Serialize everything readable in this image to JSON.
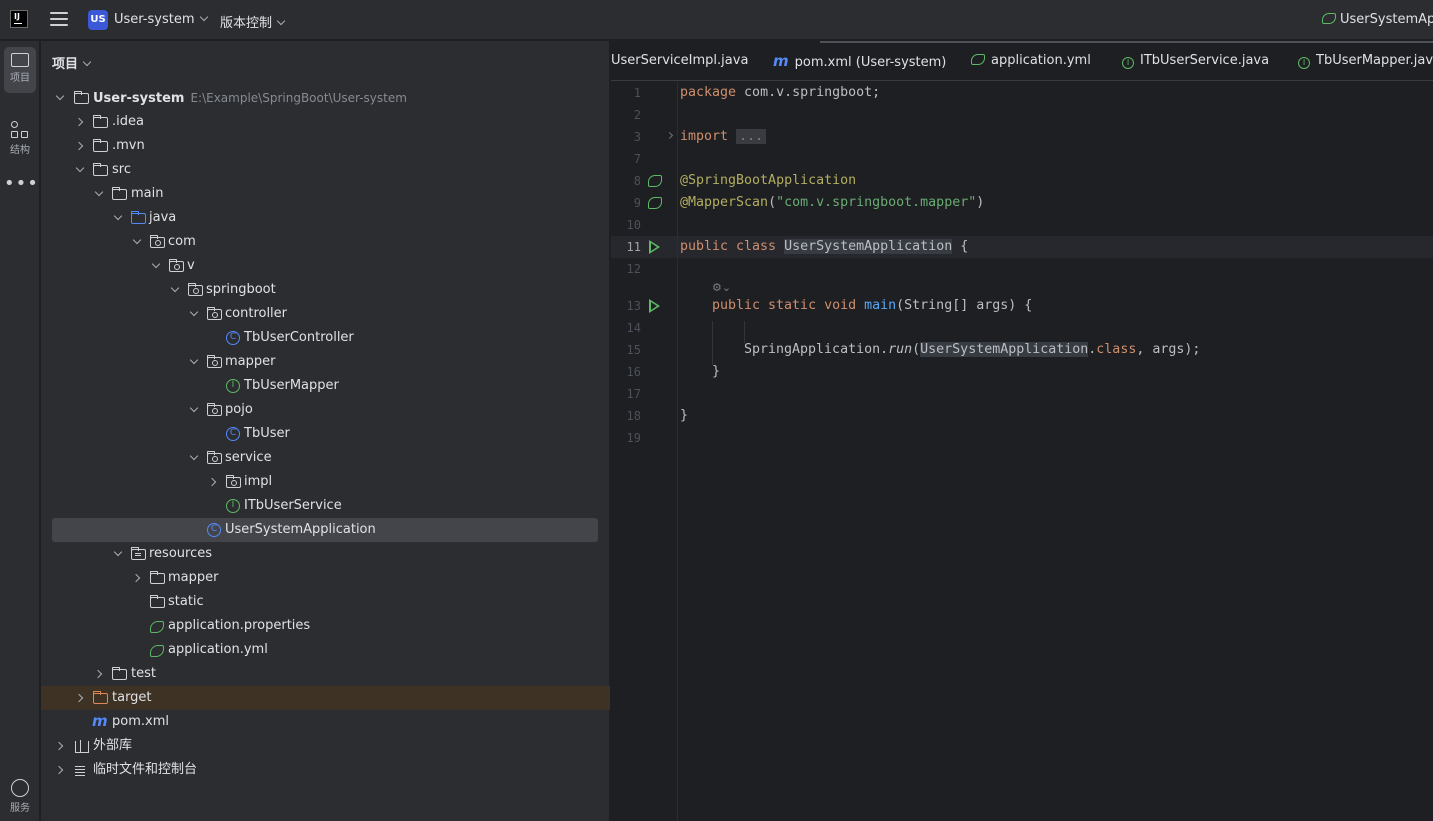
{
  "titlebar": {
    "logo_text": "IJ",
    "project_badge": "US",
    "project_name": "User-system",
    "vcs_label": "版本控制",
    "run_config": "UserSystemApp"
  },
  "strip": {
    "project_label": "项目",
    "structure_label": "结构",
    "more_label": "•••",
    "services_label": "服务"
  },
  "panel": {
    "title": "项目"
  },
  "tree": [
    {
      "label": "User-system",
      "path": "E:\\Example\\SpringBoot\\User-system"
    },
    {
      "label": ".idea"
    },
    {
      "label": ".mvn"
    },
    {
      "label": "src"
    },
    {
      "label": "main"
    },
    {
      "label": "java"
    },
    {
      "label": "com"
    },
    {
      "label": "v"
    },
    {
      "label": "springboot"
    },
    {
      "label": "controller"
    },
    {
      "label": "TbUserController"
    },
    {
      "label": "mapper"
    },
    {
      "label": "TbUserMapper"
    },
    {
      "label": "pojo"
    },
    {
      "label": "TbUser"
    },
    {
      "label": "service"
    },
    {
      "label": "impl"
    },
    {
      "label": "ITbUserService"
    },
    {
      "label": "UserSystemApplication"
    },
    {
      "label": "resources"
    },
    {
      "label": "mapper"
    },
    {
      "label": "static"
    },
    {
      "label": "application.properties"
    },
    {
      "label": "application.yml"
    },
    {
      "label": "test"
    },
    {
      "label": "target"
    },
    {
      "label": "pom.xml"
    },
    {
      "label": "外部库"
    },
    {
      "label": "临时文件和控制台"
    }
  ],
  "tabs": [
    {
      "label": "UserServiceImpl.java"
    },
    {
      "label": "pom.xml (User-system)"
    },
    {
      "label": "application.yml"
    },
    {
      "label": "ITbUserService.java"
    },
    {
      "label": "TbUserMapper.java"
    }
  ],
  "editor": {
    "line_numbers": [
      "1",
      "2",
      "3",
      "7",
      "8",
      "9",
      "10",
      "11",
      "12",
      "13",
      "14",
      "15",
      "16",
      "17",
      "18",
      "19"
    ],
    "line1_kw": "package",
    "line1_rest": " com.v.springboot;",
    "line3_kw": "import",
    "line3_fold": "...",
    "line8_ann": "@SpringBootApplication",
    "line9_ann": "@MapperScan",
    "line9_open": "(",
    "line9_str": "\"com.v.springboot.mapper\"",
    "line9_close": ")",
    "line11_kw": "public class",
    "line11_cls": "UserSystemApplication",
    "line11_rest": " {",
    "line13_kw": "public static void",
    "line13_fn": "main",
    "line13_rest": "(String[] args) {",
    "line15_pre": "SpringApplication.",
    "line15_fn": "run",
    "line15_open": "(",
    "line15_cls": "UserSystemApplication",
    "line15_dot": ".",
    "line15_kw": "class",
    "line15_rest": ", args);",
    "line16": "}",
    "line18": "}",
    "ai_hint": "⚙⌄"
  }
}
